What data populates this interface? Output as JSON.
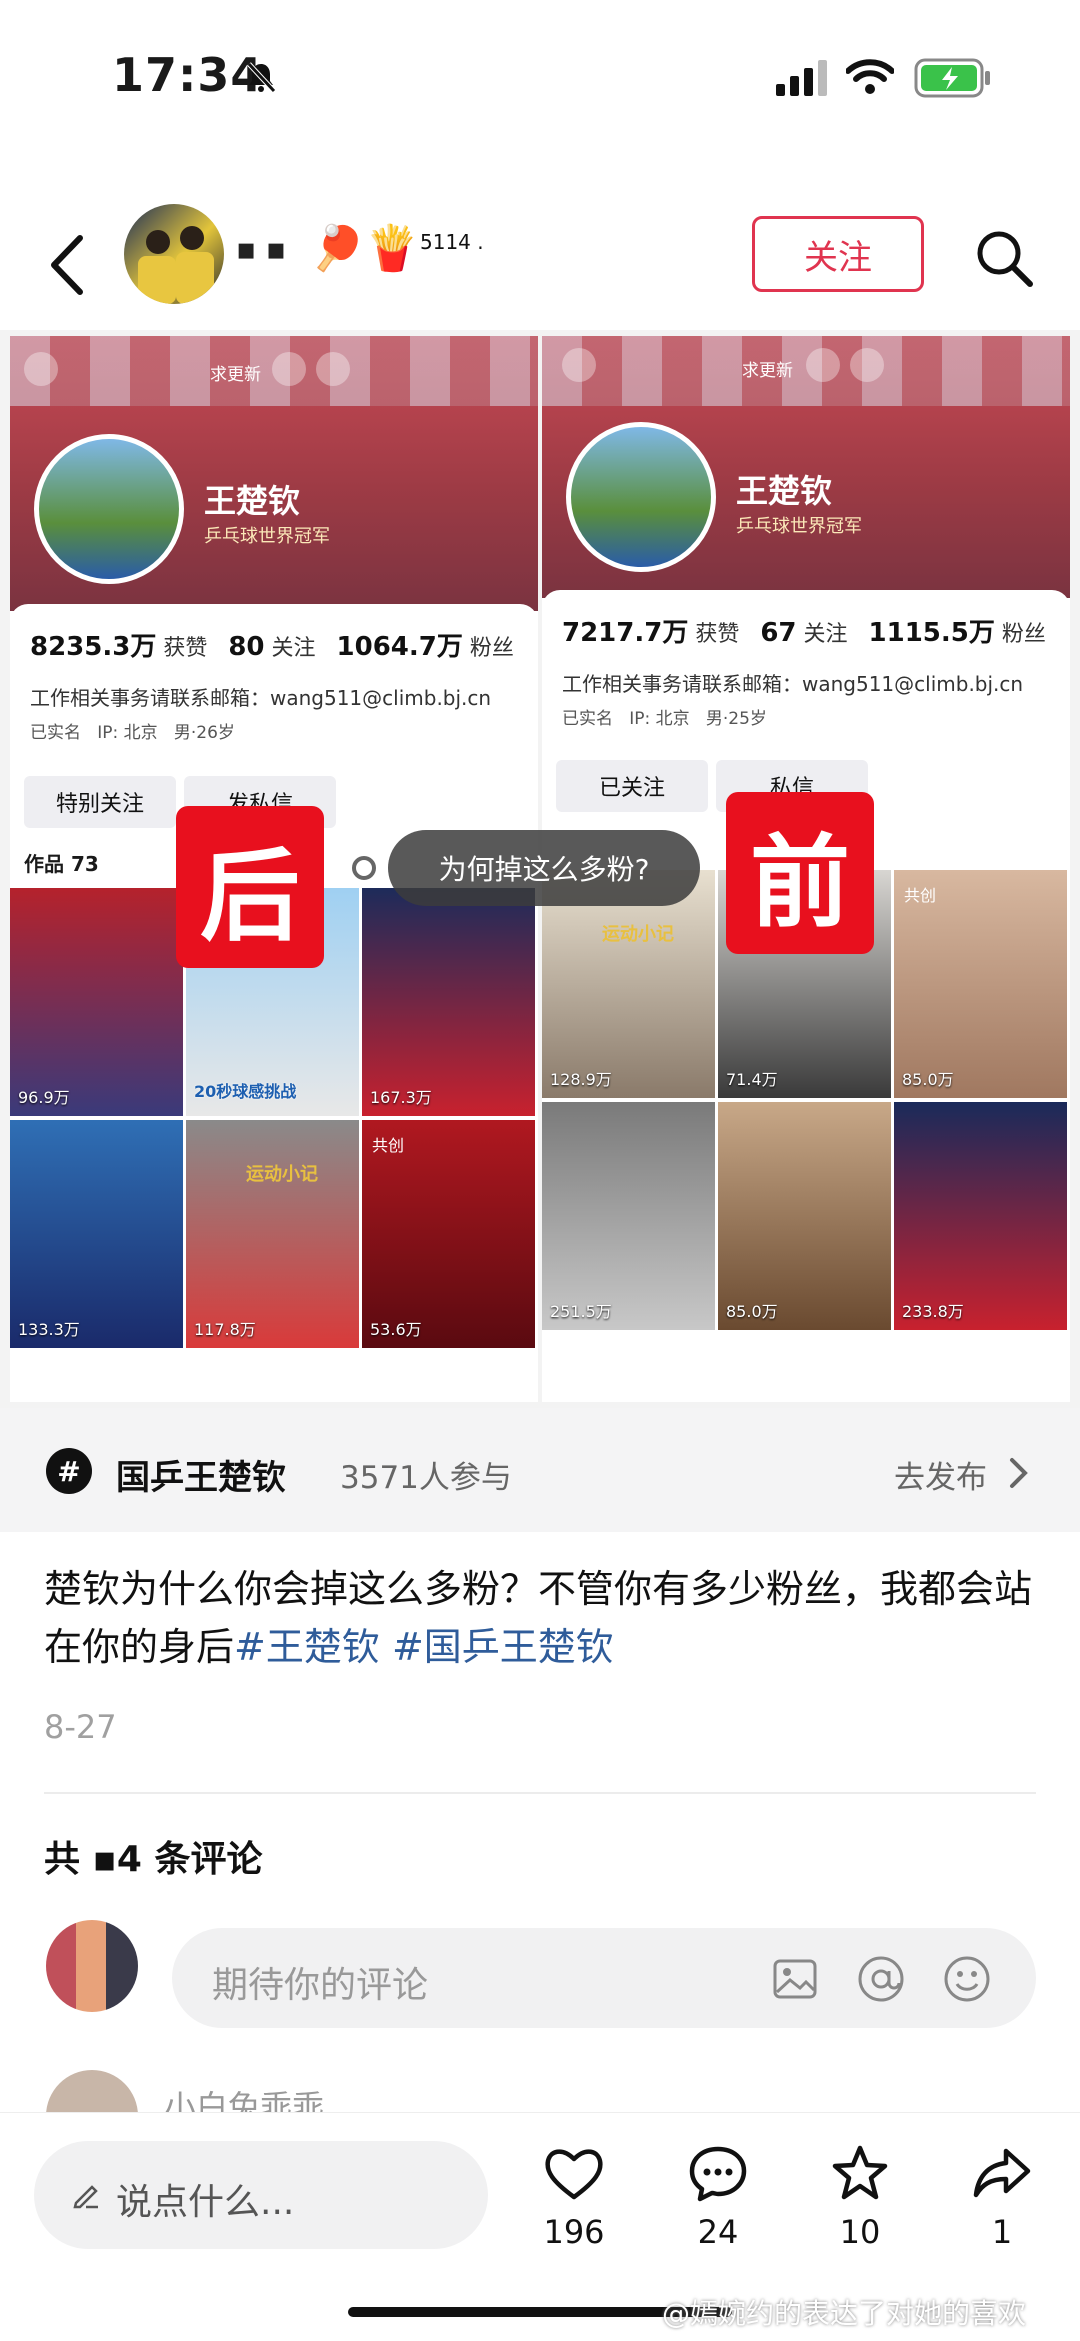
{
  "status_bar": {
    "time": "17:34"
  },
  "header": {
    "name": "▪ ▪",
    "emoji": "🏓🍟",
    "count_suffix": "5114 .",
    "follow_label": "关注"
  },
  "screenshot": {
    "left_tag": "后",
    "right_tag": "前",
    "bubble_text": "为何掉这么多粉?",
    "left_panel": {
      "top_right_action": "求更新",
      "name": "王楚钦",
      "verified": "乒乓球世界冠军",
      "likes": "8235.3万",
      "likes_label": "获赞",
      "following": "80",
      "following_label": "关注",
      "fans": "1064.7万",
      "fans_label": "粉丝",
      "email_line": "工作相关事务请联系邮箱：wang511@climb.bj.cn",
      "chip_realname": "已实名",
      "chip_ip": "IP: 北京",
      "chip_gender": "男·26岁",
      "btn_follow": "特别关注",
      "btn_msg": "发私信",
      "works": "作品 73",
      "cells": [
        {
          "likes": "96.9万",
          "caption": ""
        },
        {
          "likes": "",
          "caption": "20秒球感挑战"
        },
        {
          "likes": "167.3万",
          "caption": ""
        },
        {
          "likes": "133.3万",
          "caption": ""
        },
        {
          "likes": "117.8万",
          "caption": "运动小记"
        },
        {
          "likes": "53.6万",
          "caption": "共创"
        }
      ]
    },
    "right_panel": {
      "top_right_action": "求更新",
      "name": "王楚钦",
      "verified": "乒乓球世界冠军",
      "likes": "7217.7万",
      "likes_label": "获赞",
      "following": "67",
      "following_label": "关注",
      "fans": "1115.5万",
      "fans_label": "粉丝",
      "email_line": "工作相关事务请联系邮箱：wang511@climb.bj.cn",
      "chip_realname": "已实名",
      "chip_ip": "IP: 北京",
      "chip_gender": "男·25岁",
      "btn_follow": "已关注",
      "btn_msg": "私信",
      "cells": [
        {
          "likes": "128.9万",
          "caption": "运动小记"
        },
        {
          "likes": "71.4万",
          "caption": ""
        },
        {
          "likes": "85.0万",
          "caption": "共创"
        },
        {
          "likes": "251.5万",
          "caption": ""
        },
        {
          "likes": "85.0万",
          "caption": ""
        },
        {
          "likes": "233.8万",
          "caption": ""
        }
      ]
    }
  },
  "topic": {
    "name": "国乒王楚钦",
    "participants": "3571人参与",
    "action": "去发布"
  },
  "post": {
    "text": "楚钦为什么你会掉这么多粉？不管你有多少粉丝，我都会站在你的身后",
    "tag1": "#王楚钦",
    "tag2": "#国乒王楚钦",
    "date": "8-27"
  },
  "comments": {
    "count_label": "共 ▪4 条评论",
    "placeholder": "期待你的评论",
    "first_user": "小白兔乖乖"
  },
  "bottom_bar": {
    "say_placeholder": "说点什么...",
    "likes": "196",
    "comments": "24",
    "favorites": "10",
    "shares": "1"
  },
  "watermark": "@嫣婉约的表达了对她的喜欢",
  "colors": {
    "accent": "#e0344f",
    "tag_red": "#e8101e",
    "link": "#2f5c9a"
  }
}
